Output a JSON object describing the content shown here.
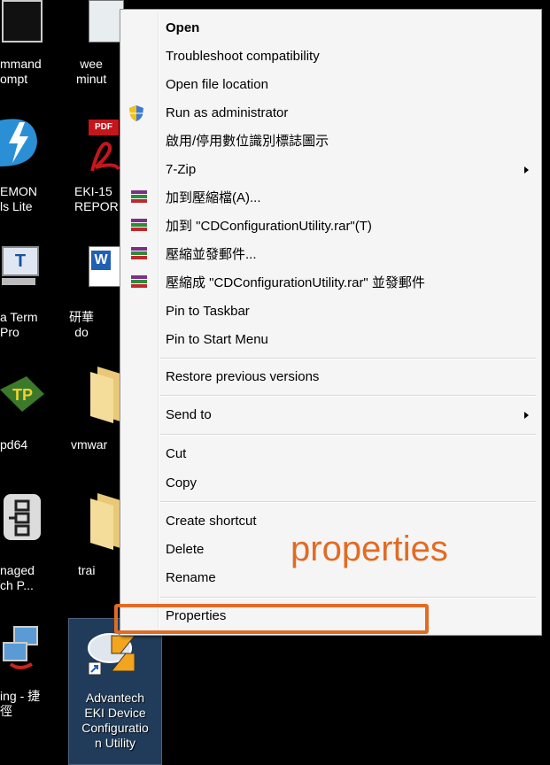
{
  "desktop": {
    "labels": [
      "mmand\nompt",
      "wee\nminut",
      "EMON\nls Lite",
      "EKI-15\nREPOR",
      "a Term\nPro",
      "研華\ndo",
      "pd64",
      "vmwar",
      "naged\nch P...",
      "trai",
      "ing - 捷\n徑",
      "Advantech\nEKI Device\nConfiguratio\nn Utility"
    ]
  },
  "menu": {
    "items": [
      {
        "label": "Open"
      },
      {
        "label": "Troubleshoot compatibility"
      },
      {
        "label": "Open file location"
      },
      {
        "label": "Run as administrator"
      },
      {
        "label": "啟用/停用數位識別標誌圖示"
      },
      {
        "label": "7-Zip"
      },
      {
        "label": "加到壓縮檔(A)..."
      },
      {
        "label": "加到 \"CDConfigurationUtility.rar\"(T)"
      },
      {
        "label": "壓縮並發郵件..."
      },
      {
        "label": "壓縮成 \"CDConfigurationUtility.rar\" 並發郵件"
      },
      {
        "label": "Pin to Taskbar"
      },
      {
        "label": "Pin to Start Menu"
      },
      {
        "label": "Restore previous versions"
      },
      {
        "label": "Send to"
      },
      {
        "label": "Cut"
      },
      {
        "label": "Copy"
      },
      {
        "label": "Create shortcut"
      },
      {
        "label": "Delete"
      },
      {
        "label": "Rename"
      },
      {
        "label": "Properties"
      }
    ]
  },
  "annotation": {
    "text": "properties"
  },
  "colors": {
    "accent": "#e26b24",
    "menu_bg": "#f5f5f5",
    "desktop_bg": "#000000"
  }
}
